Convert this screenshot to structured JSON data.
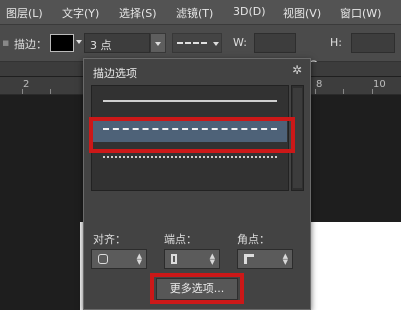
{
  "menu": [
    "图层(L)",
    "文字(Y)",
    "选择(S)",
    "滤镜(T)",
    "3D(D)",
    "视图(V)",
    "窗口(W)"
  ],
  "options": {
    "stroke_label": "描边：",
    "stroke_width": "3 点",
    "w_label": "W:",
    "h_label": "H:"
  },
  "ruler": {
    "marks": [
      "2",
      "8",
      "10"
    ]
  },
  "panel": {
    "title": "描边选项",
    "align_label": "对齐：",
    "caps_label": "端点：",
    "corners_label": "角点：",
    "more_button": "更多选项..."
  },
  "icons": [
    "gear-icon",
    "link-icon",
    "chevron-down-icon",
    "up-down-arrows-icon",
    "align-icon",
    "cap-icon",
    "corner-icon"
  ],
  "colors": {
    "highlight": "#cc1818",
    "selected_row": "#4e6278",
    "panel_bg": "#434343"
  }
}
